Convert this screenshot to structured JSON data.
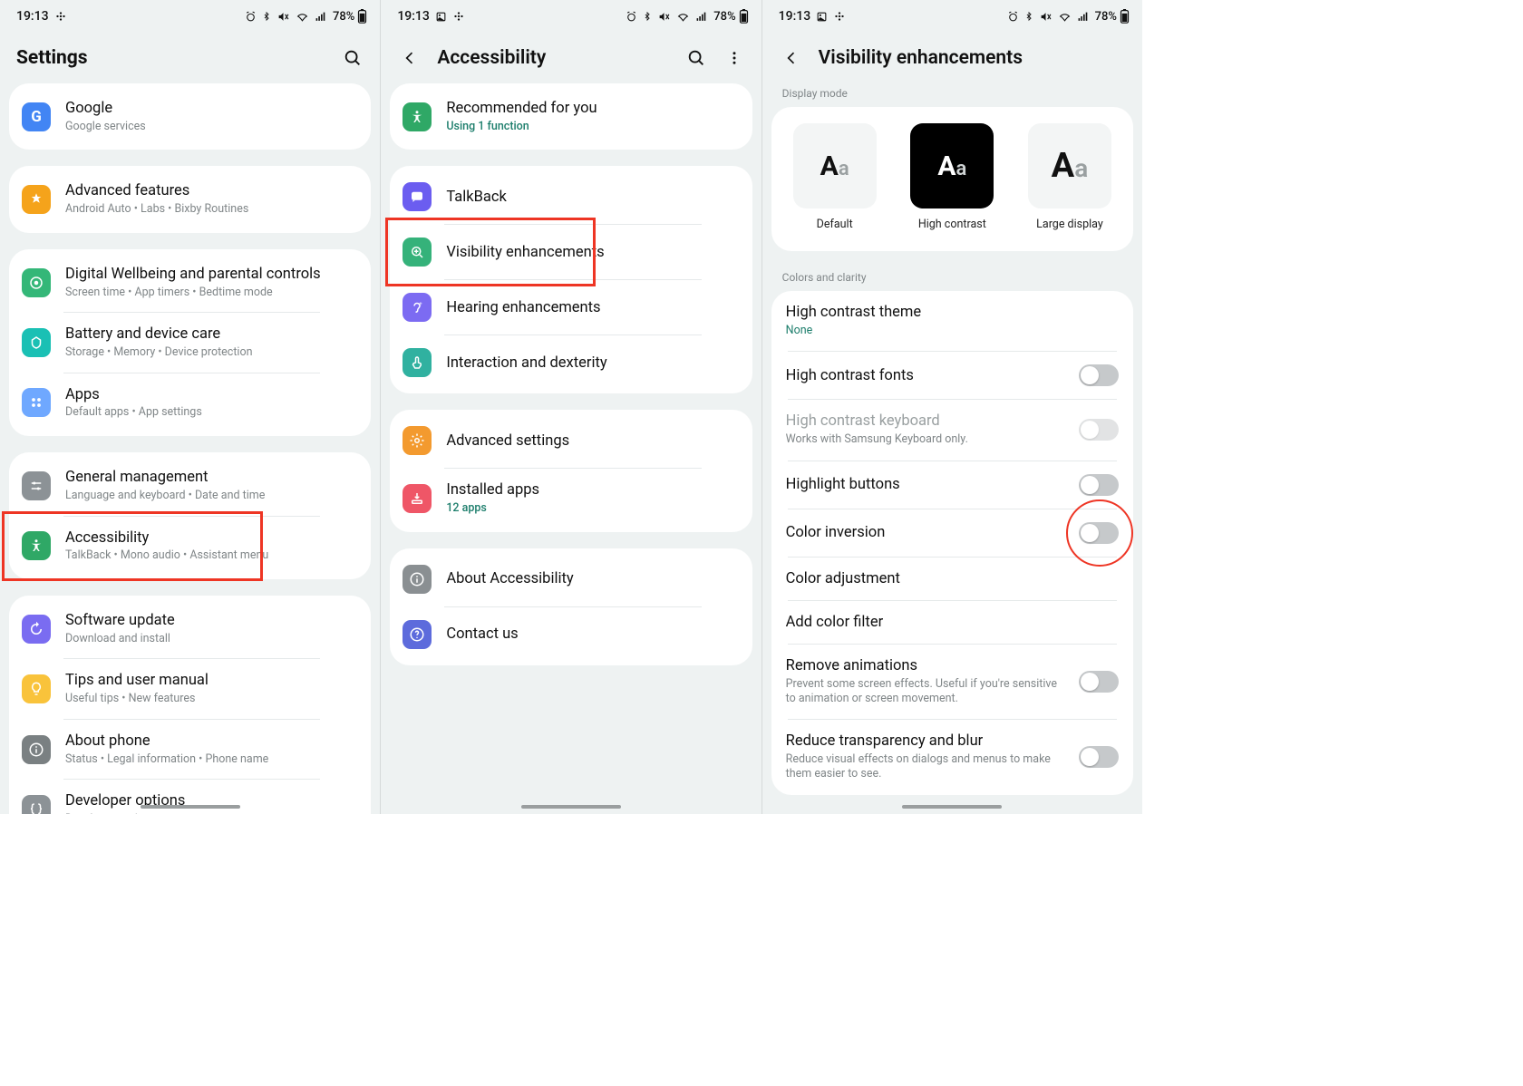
{
  "status": {
    "time": "19:13",
    "battery": "78%"
  },
  "screen1": {
    "title": "Settings",
    "groups": [
      {
        "items": [
          {
            "title": "Google",
            "subtitle": "Google services",
            "icon": "google",
            "bg": "bg-blue"
          }
        ]
      },
      {
        "items": [
          {
            "title": "Advanced features",
            "subtitle": "Android Auto  •  Labs  •  Bixby Routines",
            "icon": "star",
            "bg": "bg-orange"
          }
        ]
      },
      {
        "items": [
          {
            "title": "Digital Wellbeing and parental controls",
            "subtitle": "Screen time  •  App timers  •  Bedtime mode",
            "icon": "wellbeing",
            "bg": "bg-green"
          },
          {
            "title": "Battery and device care",
            "subtitle": "Storage  •  Memory  •  Device protection",
            "icon": "care",
            "bg": "bg-teal"
          },
          {
            "title": "Apps",
            "subtitle": "Default apps  •  App settings",
            "icon": "grid",
            "bg": "bg-grid"
          }
        ]
      },
      {
        "items": [
          {
            "title": "General management",
            "subtitle": "Language and keyboard  •  Date and time",
            "icon": "sliders",
            "bg": "bg-grey"
          },
          {
            "title": "Accessibility",
            "subtitle": "TalkBack  •  Mono audio  •  Assistant menu",
            "icon": "a11y",
            "bg": "bg-greenA",
            "highlight": true
          }
        ]
      },
      {
        "items": [
          {
            "title": "Software update",
            "subtitle": "Download and install",
            "icon": "update",
            "bg": "bg-purpleA"
          },
          {
            "title": "Tips and user manual",
            "subtitle": "Useful tips  •  New features",
            "icon": "bulb",
            "bg": "bg-yellow"
          },
          {
            "title": "About phone",
            "subtitle": "Status  •  Legal information  •  Phone name",
            "icon": "info",
            "bg": "bg-dark"
          },
          {
            "title": "Developer options",
            "subtitle": "Developer options",
            "icon": "braces",
            "bg": "bg-outline"
          }
        ]
      }
    ]
  },
  "screen2": {
    "title": "Accessibility",
    "groups": [
      {
        "items": [
          {
            "title": "Recommended for you",
            "subtitle": "Using 1 function",
            "subtitleGreen": true,
            "icon": "a11y",
            "bg": "bg-greenA"
          }
        ]
      },
      {
        "items": [
          {
            "title": "TalkBack",
            "icon": "chat",
            "bg": "bg-purple"
          },
          {
            "title": "Visibility enhancements",
            "icon": "zoom",
            "bg": "bg-greenB",
            "highlight": true
          },
          {
            "title": "Hearing enhancements",
            "icon": "ear",
            "bg": "bg-violet"
          },
          {
            "title": "Interaction and dexterity",
            "icon": "touch",
            "bg": "bg-tealC"
          }
        ]
      },
      {
        "items": [
          {
            "title": "Advanced settings",
            "icon": "gear",
            "bg": "bg-orangeC"
          },
          {
            "title": "Installed apps",
            "subtitle": "12 apps",
            "subtitleGreen": true,
            "icon": "install",
            "bg": "bg-red"
          }
        ]
      },
      {
        "items": [
          {
            "title": "About Accessibility",
            "icon": "info",
            "bg": "bg-grey2"
          },
          {
            "title": "Contact us",
            "icon": "question",
            "bg": "bg-blueQ"
          }
        ]
      }
    ]
  },
  "screen3": {
    "title": "Visibility enhancements",
    "display_mode": {
      "label": "Display mode",
      "options": [
        {
          "name": "Default",
          "dark": false,
          "large": false
        },
        {
          "name": "High contrast",
          "dark": true,
          "large": false
        },
        {
          "name": "Large display",
          "dark": false,
          "large": true
        }
      ]
    },
    "colors_label": "Colors and clarity",
    "rows": [
      {
        "title": "High contrast theme",
        "subtitle": "None",
        "subtitleGreen": true,
        "toggle": false
      },
      {
        "title": "High contrast fonts",
        "toggle": true,
        "on": false
      },
      {
        "title": "High contrast keyboard",
        "subtitle": "Works with Samsung Keyboard only.",
        "toggle": true,
        "on": false,
        "disabled": true
      },
      {
        "title": "Highlight buttons",
        "toggle": true,
        "on": false
      },
      {
        "title": "Color inversion",
        "toggle": true,
        "on": false,
        "circle": true
      },
      {
        "title": "Color adjustment",
        "toggle": false
      },
      {
        "title": "Add color filter",
        "toggle": false
      },
      {
        "title": "Remove animations",
        "subtitle": "Prevent some screen effects. Useful if you're sensitive to animation or screen movement.",
        "toggle": true,
        "on": false
      },
      {
        "title": "Reduce transparency and blur",
        "subtitle": "Reduce visual effects on dialogs and menus to make them easier to see.",
        "toggle": true,
        "on": false
      }
    ]
  }
}
